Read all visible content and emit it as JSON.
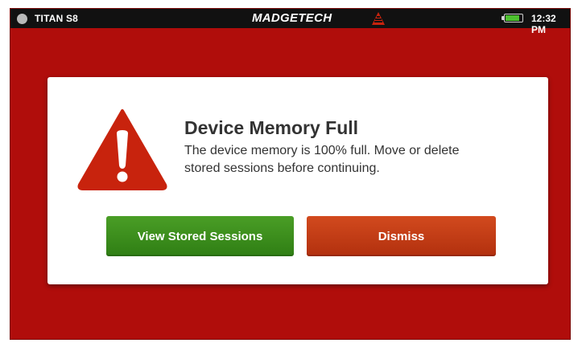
{
  "status_bar": {
    "device_name": "TITAN S8",
    "brand": "MADGETECH",
    "logo_icon": "madgetech-logo-icon",
    "battery_level": 0.85,
    "time": "12:32 PM"
  },
  "dialog": {
    "icon": "warning-icon",
    "title": "Device Memory Full",
    "message": "The device memory is 100% full. Move or delete stored sessions before continuing.",
    "buttons": {
      "view_sessions": "View Stored Sessions",
      "dismiss": "Dismiss"
    }
  },
  "colors": {
    "background": "#b00d0b",
    "status_bar": "#111111",
    "warning": "#c8230d",
    "view_button": "#3a8c1b",
    "dismiss_button": "#c33d14",
    "battery": "#4cc02e"
  }
}
